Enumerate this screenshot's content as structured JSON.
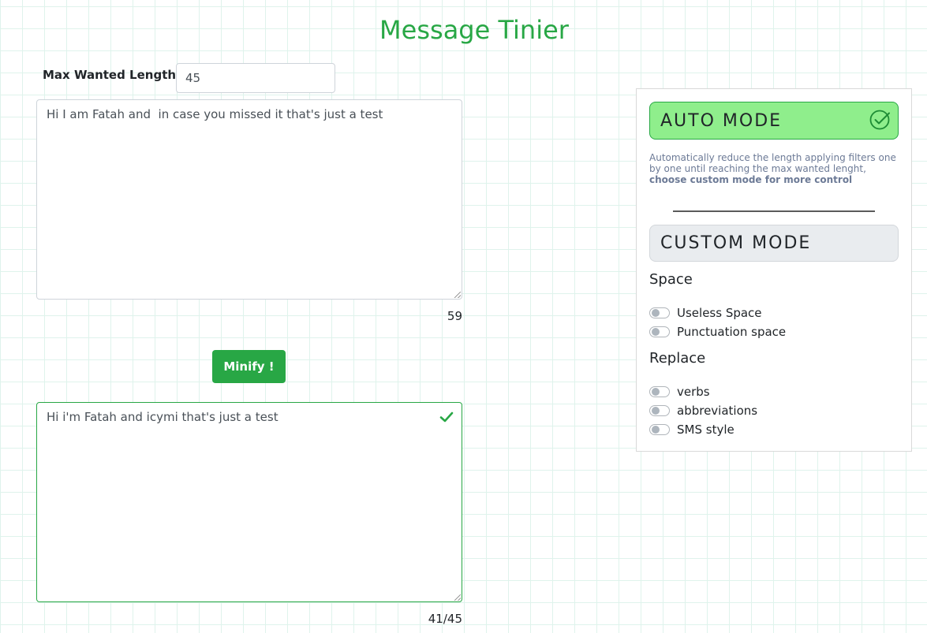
{
  "app": {
    "title": "Message Tinier"
  },
  "form": {
    "max_length_label": "Max Wanted Length :",
    "max_length_value": "45",
    "input_text": "Hi I am Fatah and  in case you missed it that's just a test",
    "input_count": "59",
    "minify_label": "Minify !",
    "output_text": "Hi i'm Fatah and icymi that's just a test",
    "output_count": "41/45"
  },
  "panel": {
    "auto_mode_label": "AUTO MODE",
    "auto_mode_active": true,
    "auto_desc": "Automatically reduce the length applying filters one by one until reaching the max wanted lenght, ",
    "auto_desc_strong": "choose custom mode for more control",
    "custom_mode_label": "CUSTOM MODE",
    "space": {
      "title": "Space",
      "options": [
        {
          "label": "Useless Space",
          "checked": false
        },
        {
          "label": "Punctuation space",
          "checked": false
        }
      ]
    },
    "replace": {
      "title": "Replace",
      "options": [
        {
          "label": "verbs",
          "checked": false
        },
        {
          "label": "abbreviations",
          "checked": false
        },
        {
          "label": "SMS style",
          "checked": false
        }
      ]
    }
  },
  "colors": {
    "accent": "#28a745",
    "auto_mode_bg": "#8fee8c",
    "custom_mode_bg": "#e9ecef",
    "description_text": "#6c7a96"
  }
}
